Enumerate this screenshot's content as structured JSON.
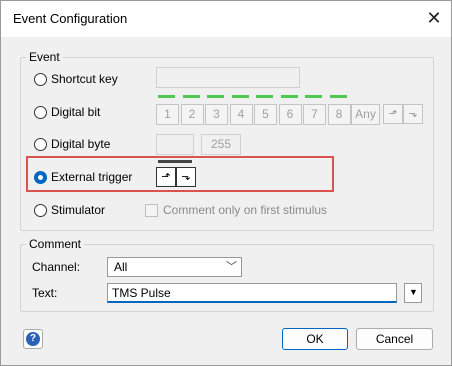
{
  "window": {
    "title": "Event Configuration"
  },
  "event_group": {
    "legend": "Event",
    "options": [
      {
        "label": "Shortcut key",
        "selected": false
      },
      {
        "label": "Digital bit",
        "selected": false
      },
      {
        "label": "Digital byte",
        "selected": false
      },
      {
        "label": "External trigger",
        "selected": true
      },
      {
        "label": "Stimulator",
        "selected": false
      }
    ],
    "digital_bits": [
      "1",
      "2",
      "3",
      "4",
      "5",
      "6",
      "7",
      "8"
    ],
    "any_label": "Any",
    "byte_value": "255",
    "stimulator_checkbox_label": "Comment only on first stimulus",
    "icons": {
      "rising": "rising-edge-icon",
      "falling": "falling-edge-icon"
    }
  },
  "comment_group": {
    "legend": "Comment",
    "channel_label": "Channel:",
    "channel_value": "All",
    "text_label": "Text:",
    "text_value": "TMS Pulse"
  },
  "buttons": {
    "ok": "OK",
    "cancel": "Cancel",
    "help": "?"
  },
  "colors": {
    "accent": "#0067c0",
    "led": "#4ec94e",
    "highlight": "#d9534f"
  }
}
